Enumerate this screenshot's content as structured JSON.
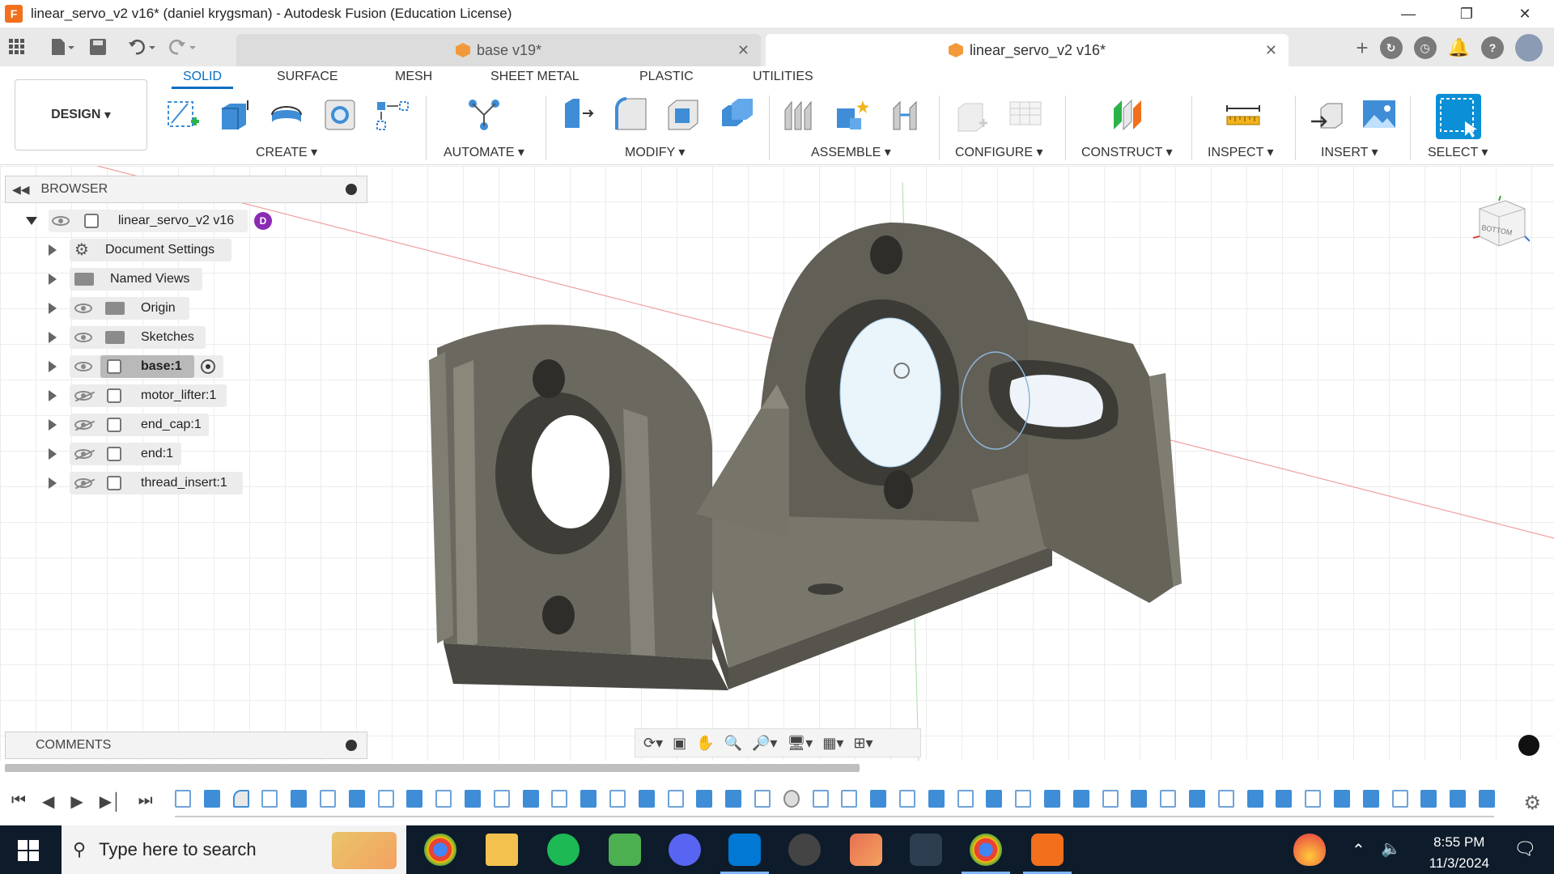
{
  "window": {
    "title": "linear_servo_v2 v16* (daniel krygsman) - Autodesk Fusion (Education License)",
    "logo_letter": "F"
  },
  "tabs": [
    {
      "label": "base v19*"
    },
    {
      "label": "linear_servo_v2 v16*"
    }
  ],
  "ribbon": {
    "workspace": "DESIGN",
    "tabs": [
      "SOLID",
      "SURFACE",
      "MESH",
      "SHEET METAL",
      "PLASTIC",
      "UTILITIES"
    ],
    "groups": [
      "CREATE",
      "AUTOMATE",
      "MODIFY",
      "ASSEMBLE",
      "CONFIGURE",
      "CONSTRUCT",
      "INSPECT",
      "INSERT",
      "SELECT"
    ]
  },
  "browser": {
    "title": "BROWSER",
    "root": "linear_servo_v2 v16",
    "root_badge": "D",
    "items": [
      {
        "label": "Document Settings",
        "icon": "gear-icon"
      },
      {
        "label": "Named Views",
        "icon": "folder-icon"
      },
      {
        "label": "Origin",
        "icon": "folder-icon",
        "visible": true
      },
      {
        "label": "Sketches",
        "icon": "folder-icon",
        "visible": true
      },
      {
        "label": "base:1",
        "icon": "body-icon",
        "visible": true,
        "active": true
      },
      {
        "label": "motor_lifter:1",
        "icon": "body-icon",
        "visible": false
      },
      {
        "label": "end_cap:1",
        "icon": "body-icon",
        "visible": false
      },
      {
        "label": "end:1",
        "icon": "body-icon",
        "visible": false
      },
      {
        "label": "thread_insert:1",
        "icon": "body-icon",
        "visible": false
      }
    ]
  },
  "comments": {
    "title": "COMMENTS"
  },
  "viewcube": {
    "label": "BOTTOM"
  },
  "taskbar": {
    "search_placeholder": "Type here to search",
    "time": "8:55 PM",
    "date": "11/3/2024"
  },
  "colors": {
    "accent": "#0b6ec1",
    "model": "#6d6b61",
    "taskbar": "#0d1b2a"
  }
}
